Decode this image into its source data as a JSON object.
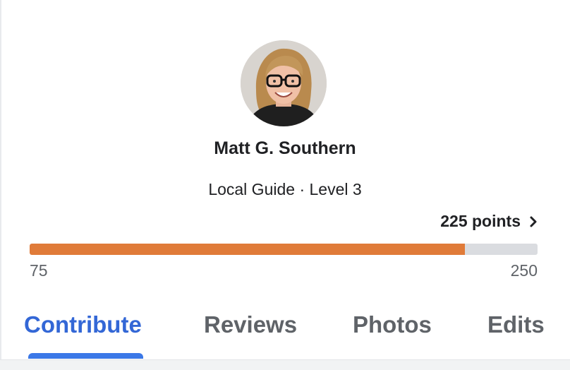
{
  "profile": {
    "name": "Matt G. Southern",
    "subtitle": "Local Guide · Level 3",
    "avatar_icon": "user-photo"
  },
  "points": {
    "label": "225 points",
    "chevron_icon": "chevron-right-icon"
  },
  "progress": {
    "min_label": "75",
    "max_label": "250",
    "min": 75,
    "max": 250,
    "value": 225,
    "fill_color": "#e07b39",
    "track_color": "#dadce0"
  },
  "tabs": [
    {
      "label": "Contribute",
      "active": true
    },
    {
      "label": "Reviews",
      "active": false
    },
    {
      "label": "Photos",
      "active": false
    },
    {
      "label": "Edits",
      "active": false
    }
  ],
  "colors": {
    "accent": "#3b78e7",
    "active_tab_text": "#3367d6",
    "inactive_tab_text": "#5f6368"
  }
}
